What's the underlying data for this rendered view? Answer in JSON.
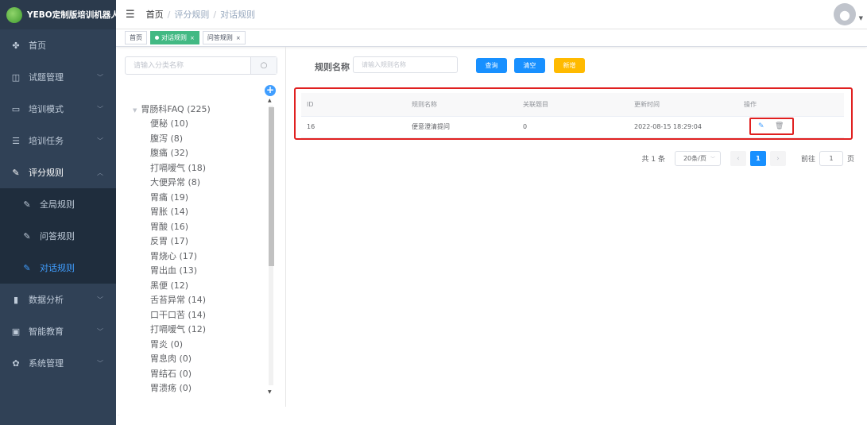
{
  "sidebar": {
    "logo_text": "YEBO定制版培训机器人",
    "items": [
      {
        "label": "首页",
        "icon": "dashboard-icon",
        "glyph": "✤"
      },
      {
        "label": "试题管理",
        "icon": "book-icon",
        "glyph": "◫"
      },
      {
        "label": "培训模式",
        "icon": "monitor-icon",
        "glyph": "▭"
      },
      {
        "label": "培训任务",
        "icon": "list-icon",
        "glyph": "☰"
      },
      {
        "label": "评分规则",
        "icon": "edit-icon",
        "glyph": "✎"
      },
      {
        "label": "数据分析",
        "icon": "chart-icon",
        "glyph": "▮"
      },
      {
        "label": "智能教育",
        "icon": "screen-icon",
        "glyph": "▣"
      },
      {
        "label": "系统管理",
        "icon": "gear-icon",
        "glyph": "✿"
      }
    ],
    "sub_items": [
      {
        "label": "全局规则",
        "icon": "edit-icon"
      },
      {
        "label": "问答规则",
        "icon": "edit-icon"
      },
      {
        "label": "对话规则",
        "icon": "edit-icon"
      }
    ]
  },
  "header": {
    "breadcrumb": [
      "首页",
      "评分规则",
      "对话规则"
    ]
  },
  "tags": [
    {
      "label": "首页"
    },
    {
      "label": "对话规则"
    },
    {
      "label": "问答规则"
    }
  ],
  "tree": {
    "search_placeholder": "请输入分类名称",
    "root": "胃肠科FAQ (225)",
    "children": [
      "便秘 (10)",
      "腹泻 (8)",
      "腹痛 (32)",
      "打嗝嗳气 (18)",
      "大便异常 (8)",
      "胃痛 (19)",
      "胃胀 (14)",
      "胃酸 (16)",
      "反胃 (17)",
      "胃烧心 (17)",
      "胃出血 (13)",
      "黑便 (12)",
      "舌苔异常 (14)",
      "口干口苦 (14)",
      "打嗝嗳气 (12)",
      "胃炎 (0)",
      "胃息肉 (0)",
      "胃结石 (0)",
      "胃溃疡 (0)"
    ]
  },
  "filter": {
    "label": "规则名称",
    "placeholder": "请输入规则名称",
    "query_button": "查询",
    "clear_button": "清空",
    "add_button": "新增"
  },
  "table": {
    "headers": [
      "ID",
      "规则名称",
      "关联题目",
      "更新时间",
      "操作"
    ],
    "rows": [
      {
        "id": "16",
        "name": "便意澄清提问",
        "related": "0",
        "updated": "2022-08-15 18:29:04"
      }
    ]
  },
  "pagination": {
    "total": "共 1 条",
    "page_size": "20条/页",
    "current": "1",
    "goto_label": "前往",
    "goto_value": "1",
    "page_suffix": "页"
  }
}
